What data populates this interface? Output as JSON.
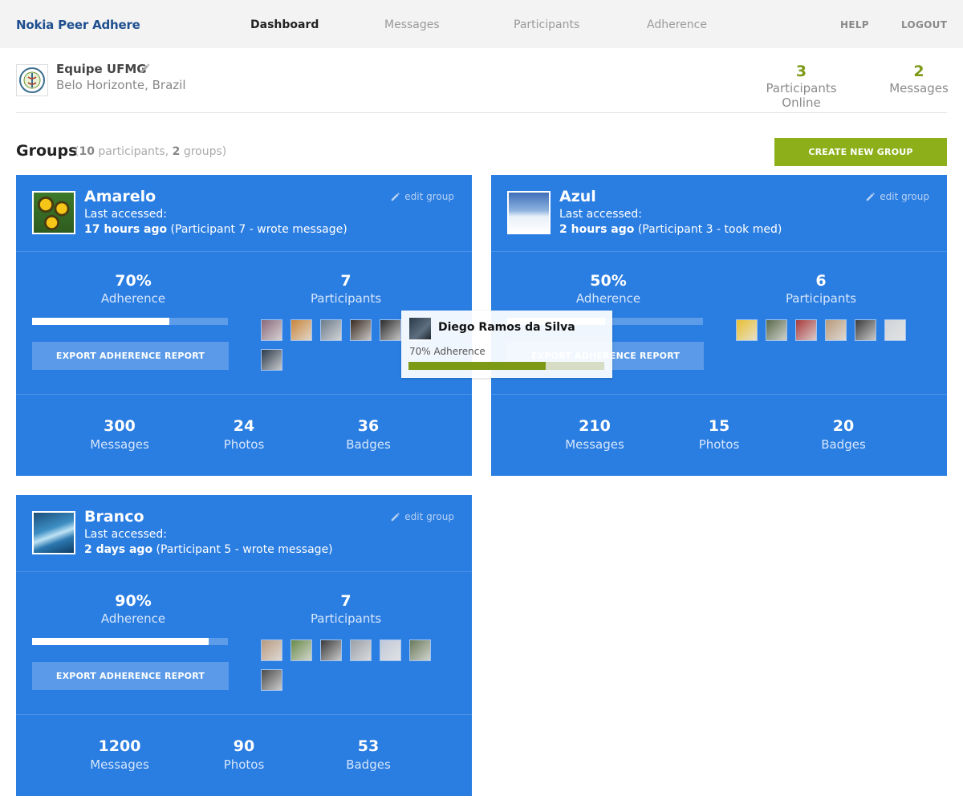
{
  "app": {
    "brand": "Nokia Peer Adhere"
  },
  "nav": {
    "items": [
      "Dashboard",
      "Messages",
      "Participants",
      "Adherence"
    ],
    "active": "Dashboard"
  },
  "top_links": {
    "help": "HELP",
    "logout": "LOGOUT"
  },
  "org": {
    "name": "Equipe UFMG",
    "location": "Belo Horizonte, Brazil",
    "stats": [
      {
        "value": "3",
        "label": "Participants Online"
      },
      {
        "value": "2",
        "label": "Messages"
      }
    ]
  },
  "groups_header": {
    "title": "Groups",
    "open": "(",
    "participants_count": "10",
    "participants_word": " participants, ",
    "groups_count": "2",
    "groups_word": " groups)",
    "create_label": "CREATE NEW GROUP"
  },
  "colors": {
    "card_blue": "#2a7de1",
    "accent_green": "#8db01a",
    "brand_navy": "#1f4f8f"
  },
  "groups": [
    {
      "name": "Amarelo",
      "last_label": "Last accessed:",
      "last_time": "17 hours ago",
      "last_detail": " (Participant 7 - wrote message)",
      "edit_label": "edit group",
      "adherence_text": "70%",
      "adherence_fraction": 0.7,
      "adherence_label": "Adherence",
      "export_label": "EXPORT ADHERENCE REPORT",
      "participants_count": "7",
      "participants_label": "Participants",
      "messages": "300",
      "messages_label": "Messages",
      "photos": "24",
      "photos_label": "Photos",
      "badges": "36",
      "badges_label": "Badges"
    },
    {
      "name": "Azul",
      "last_label": "Last accessed:",
      "last_time": "2 hours ago",
      "last_detail": " (Participant 3 - took med)",
      "edit_label": "edit group",
      "adherence_text": "50%",
      "adherence_fraction": 0.5,
      "adherence_label": "Adherence",
      "export_label": "EXPORT ADHERENCE REPORT",
      "participants_count": "6",
      "participants_label": "Participants",
      "messages": "210",
      "messages_label": "Messages",
      "photos": "15",
      "photos_label": "Photos",
      "badges": "20",
      "badges_label": "Badges"
    },
    {
      "name": "Branco",
      "last_label": "Last accessed:",
      "last_time": "2 days ago",
      "last_detail": " (Participant 5 - wrote message)",
      "edit_label": "edit group",
      "adherence_text": "90%",
      "adherence_fraction": 0.9,
      "adherence_label": "Adherence",
      "export_label": "EXPORT ADHERENCE REPORT",
      "participants_count": "7",
      "participants_label": "Participants",
      "messages": "1200",
      "messages_label": "Messages",
      "photos": "90",
      "photos_label": "Photos",
      "badges": "53",
      "badges_label": "Badges"
    }
  ],
  "tooltip": {
    "name": "Diego Ramos da Silva",
    "adherence_text": "70% Adherence",
    "adherence_fraction": 0.7
  }
}
